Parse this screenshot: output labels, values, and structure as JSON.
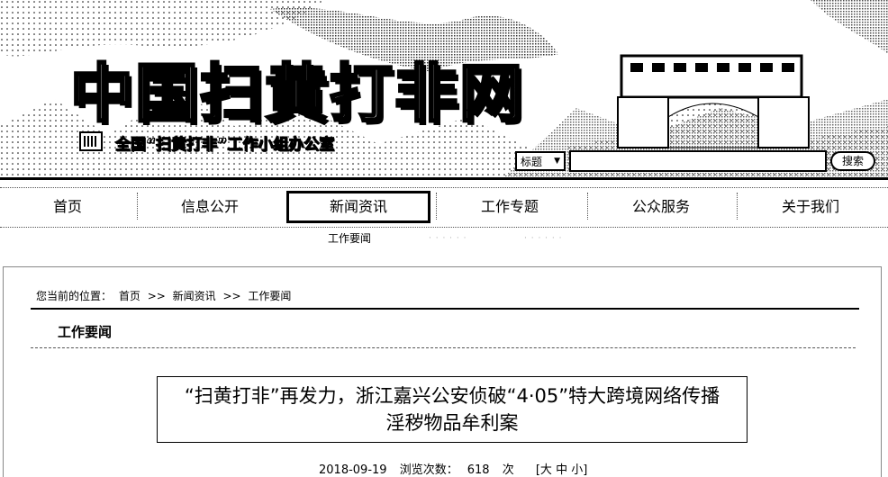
{
  "header": {
    "site_title": "中国扫黄打非网",
    "office_name": "全国“扫黄打非”工作小组办公室",
    "logo_icon": "seal-icon",
    "search": {
      "field_select": "标题",
      "input_value": "",
      "button_label": "搜索"
    }
  },
  "nav": {
    "items": [
      {
        "label": "首页"
      },
      {
        "label": "信息公开"
      },
      {
        "label": "新闻资讯"
      },
      {
        "label": "工作专题"
      },
      {
        "label": "公众服务"
      },
      {
        "label": "关于我们"
      }
    ],
    "active_label": "新闻资讯",
    "subnav": [
      "工作要闻",
      "· · · · · ·",
      "· · · · · ·"
    ]
  },
  "breadcrumb": {
    "prefix": "您当前的位置：",
    "items": [
      "首页",
      "新闻资讯",
      "工作要闻"
    ],
    "separator": ">>"
  },
  "section": {
    "title": "工作要闻"
  },
  "article": {
    "title": "“扫黄打非”再发力，浙江嘉兴公安侦破“4·05”特大跨境网络传播淫秽物品牟利案",
    "date": "2018-09-19",
    "views_label": "浏览次数：",
    "views": "618",
    "views_unit": "次",
    "font_size": {
      "open": "[",
      "large": "大",
      "medium": "中",
      "small": "小",
      "close": "]"
    }
  },
  "colors": {
    "ink": "#000000",
    "paper": "#ffffff",
    "rule": "#555555"
  }
}
